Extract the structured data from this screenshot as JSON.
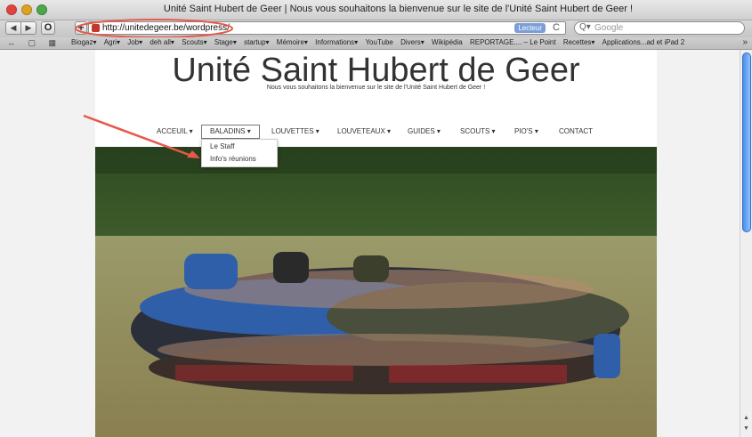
{
  "window": {
    "title": "Unité Saint Hubert de Geer | Nous vous souhaitons la bienvenue sur le site de l'Unité Saint Hubert de Geer !"
  },
  "toolbar": {
    "back_glyph": "◀",
    "forward_glyph": "▶",
    "opera_glyph": "O",
    "add_glyph": "+",
    "url": "http://unitedegeer.be/wordpress/",
    "reader_label": "Lecteur",
    "reload_glyph": "C",
    "search_icon": "Q▾",
    "search_placeholder": "Google"
  },
  "bookmarks": {
    "icons": "↔ ▢ ▦",
    "items": [
      "Biogaz▾",
      "Agri▾",
      "Job▾",
      "deh all▾",
      "Scouts▾",
      "Stage▾",
      "startup▾",
      "Mémoire▾",
      "Informations▾",
      "YouTube",
      "Divers▾",
      "Wikipédia",
      "REPORTAGE.... – Le Point",
      "Recettes▾",
      "Applications...ad et iPad 2"
    ],
    "more": "»"
  },
  "site": {
    "title": "Unité Saint Hubert de Geer",
    "tagline": "Nous vous souhaitons la bienvenue sur le site de l'Unité Saint Hubert de Geer !",
    "nav": [
      "ACCEUIL ▾",
      "BALADINS ▾",
      "LOUVETTES ▾",
      "LOUVETEAUX ▾",
      "GUIDES ▾",
      "SCOUTS ▾",
      "PIO'S ▾",
      "CONTACT"
    ],
    "dropdown": [
      "Le Staff",
      "Info's réunions"
    ]
  },
  "colors": {
    "annotation": "#e8584a",
    "scroll_thumb": "#4d8ee8"
  }
}
